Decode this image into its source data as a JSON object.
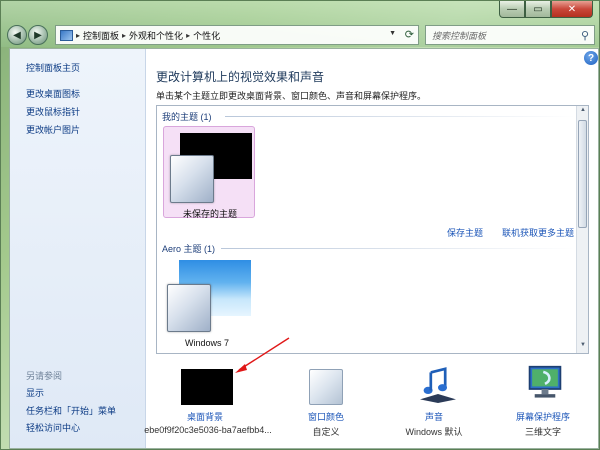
{
  "window": {
    "controls": {
      "minimize": "—",
      "maximize": "▭",
      "close": "✕"
    }
  },
  "address_bar": {
    "crumbs": [
      "控制面板",
      "外观和个性化",
      "个性化"
    ],
    "separator": "▸"
  },
  "search": {
    "placeholder": "搜索控制面板"
  },
  "left_nav": {
    "links": [
      "控制面板主页",
      "更改桌面图标",
      "更改鼠标指针",
      "更改帐户图片"
    ],
    "see_also_title": "另请参阅",
    "see_also_links": [
      "显示",
      "任务栏和「开始」菜单",
      "轻松访问中心"
    ]
  },
  "main": {
    "title": "更改计算机上的视觉效果和声音",
    "description": "单击某个主题立即更改桌面背景、窗口颜色、声音和屏幕保护程序。",
    "my_themes": {
      "header": "我的主题 (1)",
      "items": [
        {
          "label": "未保存的主题",
          "selected": true
        }
      ],
      "save_link": "保存主题",
      "online_link": "联机获取更多主题"
    },
    "aero_themes": {
      "header": "Aero 主题 (1)",
      "items": [
        {
          "label": "Windows 7"
        }
      ]
    }
  },
  "bottom": [
    {
      "label": "桌面背景",
      "sub": "ebe0f9f20c3e5036-ba7aefbb4..."
    },
    {
      "label": "窗口颜色",
      "sub": "自定义"
    },
    {
      "label": "声音",
      "sub": "Windows 默认"
    },
    {
      "label": "屏幕保护程序",
      "sub": "三维文字"
    }
  ],
  "colors": {
    "link": "#1c56b8",
    "selected_tile": "#f5e0f6",
    "annotation_arrow": "#e01818"
  }
}
